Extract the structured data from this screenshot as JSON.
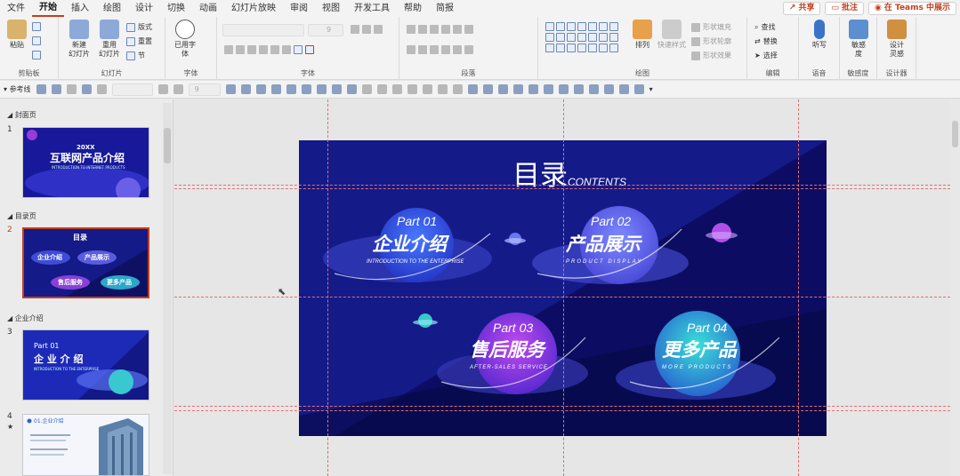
{
  "menu": {
    "tabs": [
      "文件",
      "开始",
      "插入",
      "绘图",
      "设计",
      "切换",
      "动画",
      "幻灯片放映",
      "审阅",
      "视图",
      "开发工具",
      "帮助",
      "简报"
    ],
    "active": "开始",
    "share": "共享",
    "comment": "批注",
    "teams": "在 Teams 中展示"
  },
  "ribbon": {
    "clipboard": {
      "label": "剪贴板",
      "paste": "粘贴"
    },
    "slides": {
      "label": "幻灯片",
      "new": "新建\n幻灯片",
      "reuse": "重用\n幻灯片",
      "layout": "版式",
      "reset": "重置",
      "section": "节"
    },
    "fonts": {
      "label": "字体",
      "used": "已用字体"
    },
    "font": {
      "label": "字体",
      "size": "9"
    },
    "paragraph": {
      "label": "段落"
    },
    "drawing": {
      "label": "绘图",
      "arrange": "排列",
      "quickstyle": "快速样式",
      "fill": "形状填充",
      "outline": "形状轮廓",
      "effect": "形状效果"
    },
    "edit": {
      "label": "编辑",
      "find": "查找",
      "replace": "替换",
      "select": "选择"
    },
    "voice": {
      "label": "语音",
      "dictate": "听写"
    },
    "sensitivity": {
      "label": "敏感度",
      "btn": "敏感\n度"
    },
    "designer": {
      "label": "设计器",
      "btn": "设计\n灵感"
    }
  },
  "qat": {
    "guides": "参考线",
    "font_size": "9"
  },
  "sections": [
    {
      "title": "封面页",
      "slide": "1"
    },
    {
      "title": "目录页",
      "slide": "2"
    },
    {
      "title": "企业介绍",
      "slide": "3"
    },
    {
      "slide": "4"
    }
  ],
  "thumbs": {
    "s1": {
      "year": "20XX",
      "title": "互联网产品介绍",
      "sub": "INTRODUCTION TO INTERNET PRODUCTS"
    },
    "s3": {
      "part": "Part 01",
      "title": "企 业 介 绍",
      "sub": "INTRODUCTION TO THE ENTERPRISE"
    },
    "s4": {
      "title": "01.企业介绍"
    }
  },
  "slide": {
    "title": "目录",
    "title_en": "CONTENTS",
    "items": [
      {
        "part": "Part 01",
        "title": "企业介绍",
        "sub": "INTRODUCTION TO THE ENTERPRISE",
        "color": "#2f6ff0"
      },
      {
        "part": "Part 02",
        "title": "产品展示",
        "sub": "PRODUCT DISPLAY",
        "color": "#5a6cf0"
      },
      {
        "part": "Part 03",
        "title": "售后服务",
        "sub": "AFTER-SALES SERVICE",
        "color": "#9a3ad8"
      },
      {
        "part": "Part 04",
        "title": "更多产品",
        "sub": "MORE PRODUCTS",
        "color": "#22b8c8"
      }
    ]
  }
}
